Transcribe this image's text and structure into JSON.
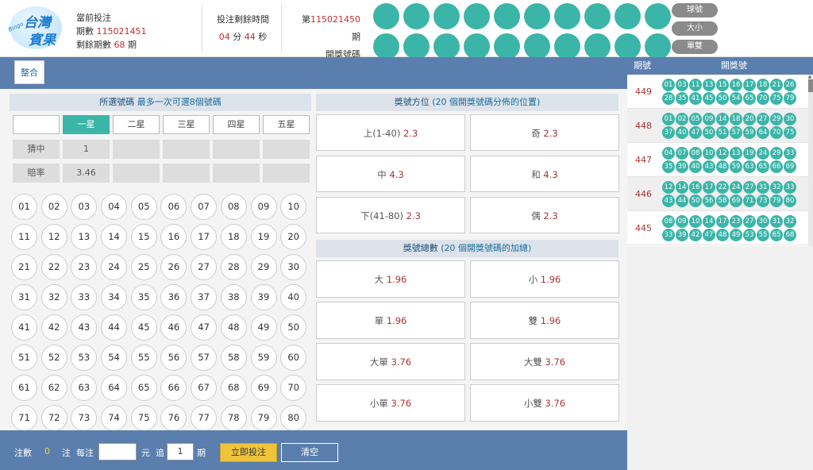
{
  "logo": {
    "line1": "台灣",
    "line2": "賓果",
    "tagline": "Bingo"
  },
  "header": {
    "current_label": "當前投注",
    "period_label": "期數",
    "period_value": "115021451",
    "remaining_label": "剩餘期數",
    "remaining_value": "68",
    "remaining_unit": "期",
    "countdown_label": "投注剩餘時間",
    "countdown_min": "04",
    "countdown_min_unit": "分",
    "countdown_sec": "44",
    "countdown_sec_unit": "秒",
    "draw_prefix": "第",
    "draw_period": "115021450",
    "draw_suffix": "期",
    "draw_label": "開獎號碼"
  },
  "mode_buttons": [
    "球號",
    "大小",
    "單雙"
  ],
  "tab": {
    "label": "整合"
  },
  "selection": {
    "title": "所選號碼",
    "subtitle": "最多一次可選8個號碼",
    "stars": [
      "",
      "一星",
      "二星",
      "三星",
      "四星",
      "五星"
    ],
    "hit_label": "猜中",
    "hit_values": [
      "1",
      "",
      "",
      "",
      ""
    ],
    "odds_label": "賠率",
    "odds_values": [
      "3.46",
      "",
      "",
      "",
      ""
    ]
  },
  "numbers": [
    "01",
    "02",
    "03",
    "04",
    "05",
    "06",
    "07",
    "08",
    "09",
    "10",
    "11",
    "12",
    "13",
    "14",
    "15",
    "16",
    "17",
    "18",
    "19",
    "20",
    "21",
    "22",
    "23",
    "24",
    "25",
    "26",
    "27",
    "28",
    "29",
    "30",
    "31",
    "32",
    "33",
    "34",
    "35",
    "36",
    "37",
    "38",
    "39",
    "40",
    "41",
    "42",
    "43",
    "44",
    "45",
    "46",
    "47",
    "48",
    "49",
    "50",
    "51",
    "52",
    "53",
    "54",
    "55",
    "56",
    "57",
    "58",
    "59",
    "60",
    "61",
    "62",
    "63",
    "64",
    "65",
    "66",
    "67",
    "68",
    "69",
    "70",
    "71",
    "72",
    "73",
    "74",
    "75",
    "76",
    "77",
    "78",
    "79",
    "80"
  ],
  "position": {
    "title": "獎號方位",
    "subtitle": "(20 個開獎號碼分佈的位置)",
    "options": [
      {
        "label": "上(1-40)",
        "odds": "2.3"
      },
      {
        "label": "奇",
        "odds": "2.3"
      },
      {
        "label": "中",
        "odds": "4.3"
      },
      {
        "label": "和",
        "odds": "4.3"
      },
      {
        "label": "下(41-80)",
        "odds": "2.3"
      },
      {
        "label": "偶",
        "odds": "2.3"
      }
    ]
  },
  "total": {
    "title": "獎號總數",
    "subtitle": "(20 個開獎號碼的加總)",
    "options": [
      {
        "label": "大",
        "odds": "1.96"
      },
      {
        "label": "小",
        "odds": "1.96"
      },
      {
        "label": "單",
        "odds": "1.96"
      },
      {
        "label": "雙",
        "odds": "1.96"
      },
      {
        "label": "大單",
        "odds": "3.76"
      },
      {
        "label": "大雙",
        "odds": "3.76"
      },
      {
        "label": "小單",
        "odds": "3.76"
      },
      {
        "label": "小雙",
        "odds": "3.76"
      }
    ]
  },
  "bottom": {
    "bets_label": "注數",
    "bets_value": "0",
    "bets_unit": "注",
    "per_label": "每注",
    "money_value": "",
    "money_unit": "元",
    "chase_label": "追",
    "chase_value": "1",
    "chase_unit": "期",
    "submit_label": "立即投注",
    "clear_label": "清空"
  },
  "history": {
    "col_period": "期號",
    "col_numbers": "開獎號",
    "rows": [
      {
        "period": "449",
        "numbers": [
          "01",
          "03",
          "11",
          "13",
          "15",
          "16",
          "17",
          "18",
          "21",
          "26",
          "28",
          "35",
          "41",
          "45",
          "50",
          "54",
          "65",
          "70",
          "75",
          "79"
        ]
      },
      {
        "period": "448",
        "numbers": [
          "01",
          "02",
          "05",
          "09",
          "14",
          "18",
          "20",
          "27",
          "29",
          "30",
          "37",
          "40",
          "47",
          "50",
          "51",
          "57",
          "59",
          "64",
          "70",
          "75"
        ]
      },
      {
        "period": "447",
        "numbers": [
          "04",
          "07",
          "08",
          "10",
          "12",
          "13",
          "19",
          "24",
          "29",
          "33",
          "35",
          "39",
          "40",
          "43",
          "48",
          "59",
          "63",
          "65",
          "66",
          "69"
        ]
      },
      {
        "period": "446",
        "numbers": [
          "12",
          "14",
          "16",
          "17",
          "22",
          "24",
          "27",
          "31",
          "32",
          "33",
          "43",
          "44",
          "50",
          "56",
          "58",
          "69",
          "71",
          "73",
          "79",
          "80"
        ]
      },
      {
        "period": "445",
        "numbers": [
          "08",
          "09",
          "10",
          "14",
          "17",
          "23",
          "27",
          "30",
          "31",
          "32",
          "33",
          "39",
          "42",
          "47",
          "48",
          "49",
          "53",
          "55",
          "65",
          "68"
        ]
      }
    ]
  },
  "colors": {
    "accent": "#3bb5a8",
    "panel": "#5a7eae",
    "odds": "#aa3333",
    "submit": "#f0c43a"
  }
}
